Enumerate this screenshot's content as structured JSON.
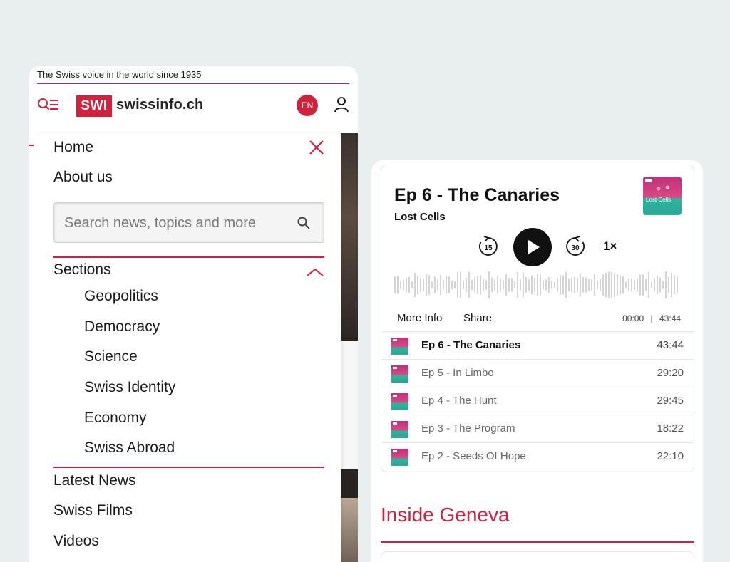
{
  "site": {
    "tagline": "The Swiss voice in the world since 1935",
    "logo_mark": "SWI",
    "logo_text": "swissinfo.ch",
    "language": "EN",
    "brand_color": "#d0223d"
  },
  "menu": {
    "top_items": [
      "Home",
      "About us"
    ],
    "search": {
      "placeholder": "Search news, topics and more",
      "value": ""
    },
    "sections_label": "Sections",
    "sections": [
      "Geopolitics",
      "Democracy",
      "Science",
      "Swiss Identity",
      "Economy",
      "Swiss Abroad"
    ],
    "bottom_items": [
      "Latest News",
      "Swiss Films",
      "Videos"
    ]
  },
  "player": {
    "episode_title": "Ep 6 - The Canaries",
    "series": "Lost Cells",
    "cover_text": "Lost Cells",
    "rewind": "15",
    "forward": "30",
    "rate": "1×",
    "more_info": "More Info",
    "share": "Share",
    "current_time": "00:00",
    "separator": "|",
    "duration": "43:44",
    "episodes": [
      {
        "title": "Ep 6 - The Canaries",
        "duration": "43:44",
        "active": true
      },
      {
        "title": "Ep 5 - In Limbo",
        "duration": "29:20",
        "active": false
      },
      {
        "title": "Ep 4 - The Hunt",
        "duration": "29:45",
        "active": false
      },
      {
        "title": "Ep 3 - The Program",
        "duration": "18:22",
        "active": false
      },
      {
        "title": "Ep 2 - Seeds Of Hope",
        "duration": "22:10",
        "active": false
      }
    ]
  },
  "section_heading": "Inside Geneva"
}
